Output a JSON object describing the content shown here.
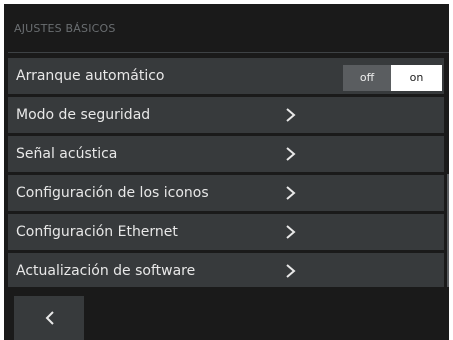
{
  "header": {
    "title": "AJUSTES BÁSICOS"
  },
  "rows": [
    {
      "label": "Arranque automático",
      "control": "toggle"
    },
    {
      "label": "Modo de seguridad",
      "control": "chevron-right-icon"
    },
    {
      "label": "Señal acústica",
      "control": "chevron-right-icon"
    },
    {
      "label": "Configuración de los iconos",
      "control": "chevron-right-icon"
    },
    {
      "label": "Configuración Ethernet",
      "control": "chevron-right-icon"
    },
    {
      "label": "Actualización de software",
      "control": "chevron-right-icon"
    }
  ],
  "toggle": {
    "off_label": "off",
    "on_label": "on",
    "selected": "on"
  },
  "footer": {
    "back_icon": "chevron-left-icon"
  },
  "colors": {
    "background": "#1a1a1a",
    "row": "#373a3c",
    "text": "#e8e8e8",
    "header_text": "#6a6e71",
    "toggle_off": "#5a5d60",
    "toggle_on": "#ffffff"
  }
}
